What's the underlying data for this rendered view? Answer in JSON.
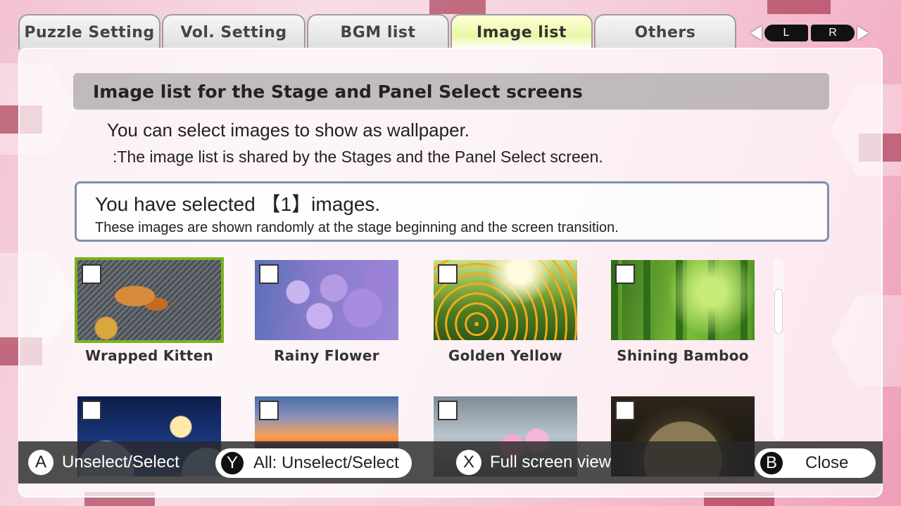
{
  "tabs": [
    {
      "label": "Puzzle Setting"
    },
    {
      "label": "Vol. Setting"
    },
    {
      "label": "BGM list"
    },
    {
      "label": "Image list"
    },
    {
      "label": "Others"
    }
  ],
  "active_tab": "Image list",
  "shoulder_buttons": {
    "left": "L",
    "right": "R"
  },
  "section": {
    "title": "Image list for the Stage and Panel Select screens",
    "description": "You can select images to show as wallpaper.",
    "note": ":The image list is shared by the Stages and the Panel Select screen."
  },
  "selection_info": {
    "title": "You have selected 【1】images.",
    "subtitle": "These images are shown randomly at the stage beginning and the screen transition."
  },
  "images": [
    {
      "label": "Wrapped Kitten",
      "selected": true
    },
    {
      "label": "Rainy Flower",
      "selected": false
    },
    {
      "label": "Golden Yellow",
      "selected": false
    },
    {
      "label": "Shining Bamboo",
      "selected": false
    },
    {
      "label": "",
      "selected": false
    },
    {
      "label": "",
      "selected": false
    },
    {
      "label": "",
      "selected": false
    },
    {
      "label": "",
      "selected": false
    }
  ],
  "controls": {
    "a_key": "A",
    "a_label": "Unselect/Select",
    "y_key": "Y",
    "y_label": "All: Unselect/Select",
    "x_key": "X",
    "x_label": "Full screen view",
    "b_key": "B",
    "b_label": "Close"
  },
  "colors": {
    "selected_border": "#78b41c",
    "active_tab": "#e9f7a6",
    "info_border": "#7f8fb0"
  }
}
